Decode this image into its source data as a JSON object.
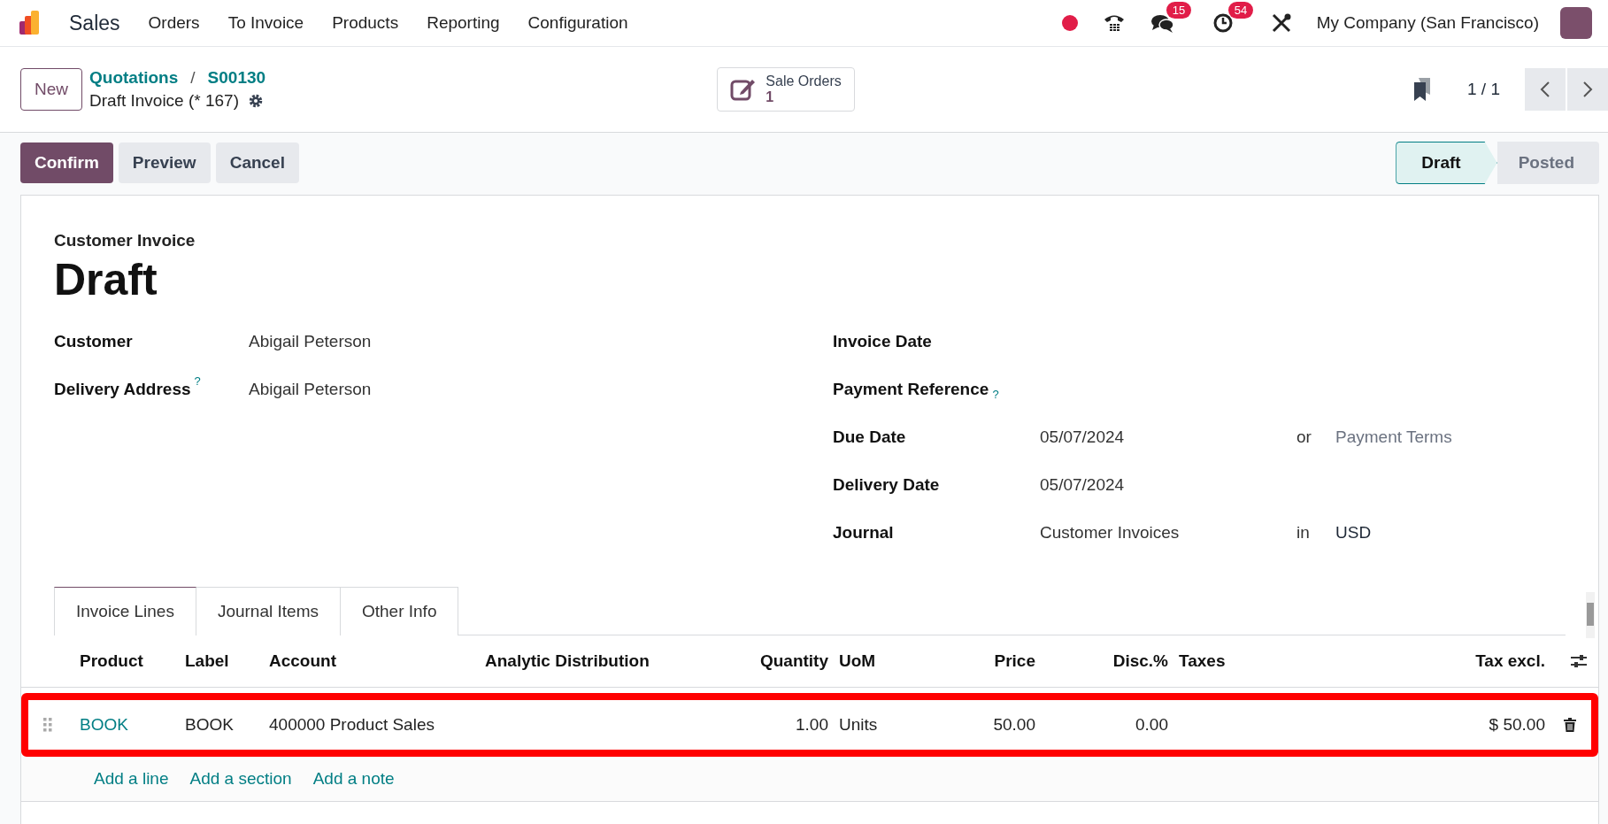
{
  "nav": {
    "app_name": "Sales",
    "menu": [
      "Orders",
      "To Invoice",
      "Products",
      "Reporting",
      "Configuration"
    ],
    "chat_count": "15",
    "activity_count": "54",
    "company": "My Company (San Francisco)"
  },
  "control_panel": {
    "new_button": "New",
    "breadcrumbs": [
      "Quotations",
      "S00130"
    ],
    "breadcrumb_separator": "/",
    "record_title": "Draft Invoice (* 167)",
    "smart_button": {
      "label": "Sale Orders",
      "count": "1"
    },
    "pager": "1 / 1"
  },
  "actions": [
    {
      "label": "Confirm",
      "kind": "primary"
    },
    {
      "label": "Preview",
      "kind": "secondary"
    },
    {
      "label": "Cancel",
      "kind": "secondary"
    }
  ],
  "status": [
    {
      "label": "Draft",
      "selected": true
    },
    {
      "label": "Posted",
      "selected": false
    }
  ],
  "form": {
    "type_label": "Customer Invoice",
    "title": "Draft",
    "left_fields": [
      {
        "label": "Customer",
        "value": "Abigail Peterson"
      },
      {
        "label": "Delivery Address",
        "value": "Abigail Peterson",
        "help": "?"
      }
    ],
    "right_fields": [
      {
        "label": "Invoice Date"
      },
      {
        "label": "Payment Reference",
        "help": "?"
      },
      {
        "label": "Due Date",
        "value": "05/07/2024",
        "joiner": "or",
        "placeholder": "Payment Terms"
      },
      {
        "label": "Delivery Date",
        "value": "05/07/2024"
      },
      {
        "label": "Journal",
        "value": "Customer Invoices",
        "joiner": "in",
        "extra": "USD"
      }
    ]
  },
  "tabs": [
    {
      "label": "Invoice Lines",
      "selected": true
    },
    {
      "label": "Journal Items",
      "selected": false
    },
    {
      "label": "Other Info",
      "selected": false
    }
  ],
  "table": {
    "columns": [
      "Product",
      "Label",
      "Account",
      "Analytic Distribution",
      "Quantity",
      "UoM",
      "Price",
      "Disc.%",
      "Taxes",
      "Tax excl."
    ],
    "rows": [
      {
        "highlighted": true,
        "cells": [
          "BOOK",
          "BOOK",
          "400000 Product Sales",
          "",
          "1.00",
          "Units",
          "50.00",
          "0.00",
          "",
          "$ 50.00"
        ]
      }
    ],
    "add_links": [
      "Add a line",
      "Add a section",
      "Add a note"
    ]
  }
}
